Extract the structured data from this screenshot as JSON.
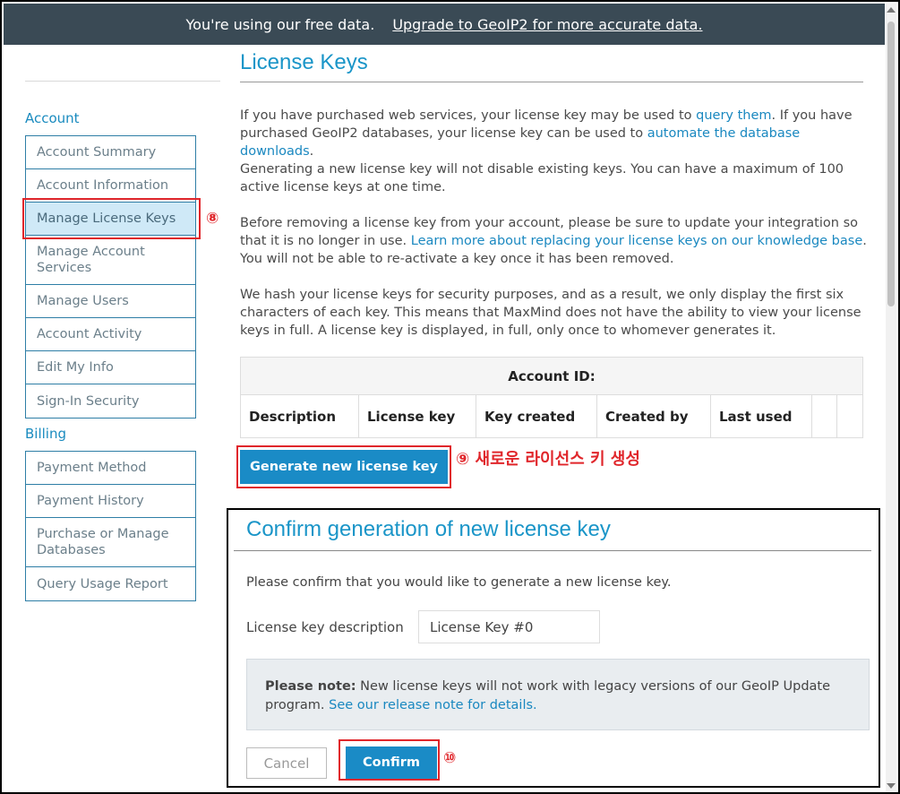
{
  "banner": {
    "text": "You're using our free data.",
    "link": "Upgrade to GeoIP2 for more accurate data."
  },
  "page": {
    "title": "License Keys"
  },
  "sidebar": {
    "account_heading": "Account",
    "account_items": [
      {
        "label": "Account Summary"
      },
      {
        "label": "Account Information"
      },
      {
        "label": "Manage License Keys"
      },
      {
        "label": "Manage Account Services"
      },
      {
        "label": "Manage Users"
      },
      {
        "label": "Account Activity"
      },
      {
        "label": "Edit My Info"
      },
      {
        "label": "Sign-In Security"
      }
    ],
    "billing_heading": "Billing",
    "billing_items": [
      {
        "label": "Payment Method"
      },
      {
        "label": "Payment History"
      },
      {
        "label": "Purchase or Manage Databases"
      },
      {
        "label": "Query Usage Report"
      }
    ]
  },
  "content": {
    "p1_a": "If you have purchased web services, your license key may be used to ",
    "p1_link1": "query them",
    "p1_b": ". If you have purchased GeoIP2 databases, your license key can be used to ",
    "p1_link2": "automate the database downloads",
    "p1_c": ".",
    "p2": "Generating a new license key will not disable existing keys. You can have a maximum of 100 active license keys at one time.",
    "p3_a": "Before removing a license key from your account, please be sure to update your integration so that it is no longer in use. ",
    "p3_link": "Learn more about replacing your license keys on our knowledge base",
    "p3_b": ". You will not be able to re-activate a key once it has been removed.",
    "p4": "We hash your license keys for security purposes, and as a result, we only display the first six characters of each key. This means that MaxMind does not have the ability to view your license keys in full. A license key is displayed, in full, only once to whomever generates it."
  },
  "table": {
    "heading": "Account ID:",
    "columns": [
      "Description",
      "License key",
      "Key created",
      "Created by",
      "Last used",
      "",
      ""
    ]
  },
  "generate_button": "Generate new license key",
  "annotations": {
    "step8": "⑧",
    "step9": "⑨ 새로운 라이선스 키 생성",
    "step10": "⑩"
  },
  "modal": {
    "title": "Confirm generation of new license key",
    "prompt": "Please confirm that you would like to generate a new license key.",
    "description_label": "License key description",
    "description_value": "License Key #0",
    "note_bold": "Please note:",
    "note_text": " New license keys will not work with legacy versions of our GeoIP Update program. ",
    "note_link": "See our release note for details.",
    "cancel": "Cancel",
    "confirm": "Confirm"
  },
  "colors": {
    "accent": "#1a8bc6",
    "banner": "#3a4a55",
    "annotation": "#e0262b",
    "active_item": "#cfe9f7"
  }
}
